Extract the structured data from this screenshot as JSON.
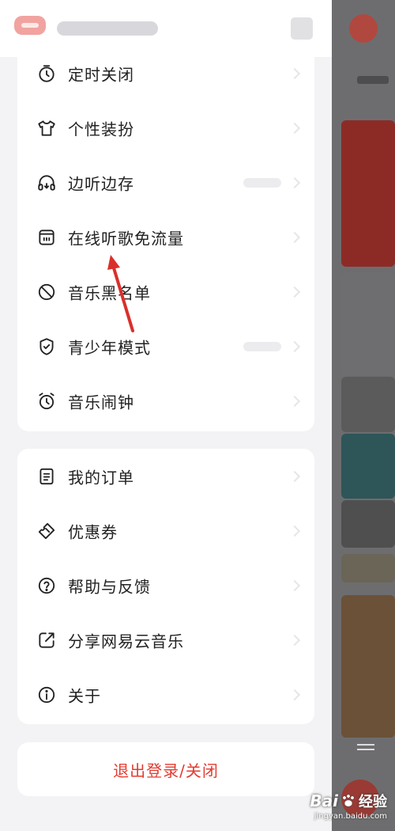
{
  "group1": [
    {
      "icon": "timer-icon",
      "label": "定时关闭",
      "has_value": false
    },
    {
      "icon": "tshirt-icon",
      "label": "个性装扮",
      "has_value": false
    },
    {
      "icon": "headphones-icon",
      "label": "边听边存",
      "has_value": true
    },
    {
      "icon": "sim-card-icon",
      "label": "在线听歌免流量",
      "has_value": false
    },
    {
      "icon": "block-icon",
      "label": "音乐黑名单",
      "has_value": false
    },
    {
      "icon": "shield-check-icon",
      "label": "青少年模式",
      "has_value": true
    },
    {
      "icon": "alarm-clock-icon",
      "label": "音乐闹钟",
      "has_value": false
    }
  ],
  "group2": [
    {
      "icon": "document-icon",
      "label": "我的订单"
    },
    {
      "icon": "coupon-icon",
      "label": "优惠券"
    },
    {
      "icon": "help-icon",
      "label": "帮助与反馈"
    },
    {
      "icon": "share-icon",
      "label": "分享网易云音乐"
    },
    {
      "icon": "info-icon",
      "label": "关于"
    }
  ],
  "logout_label": "退出登录/关闭",
  "watermark": {
    "brand": "Bai",
    "suffix": "经验",
    "url": "jingyan.baidu.com"
  },
  "colors": {
    "accent": "#e33b30",
    "annotation": "#d9302c"
  }
}
